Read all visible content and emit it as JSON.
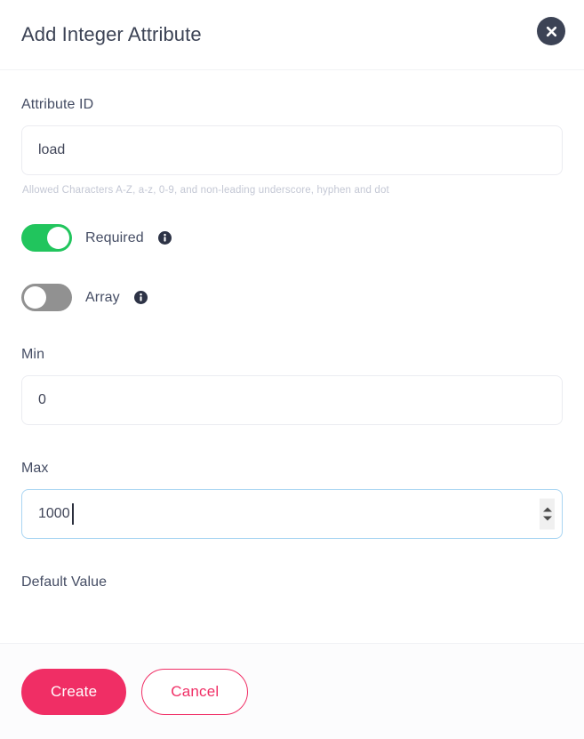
{
  "dialog": {
    "title": "Add Integer Attribute",
    "close_icon": "close-x-icon"
  },
  "form": {
    "attribute_id": {
      "label": "Attribute ID",
      "value": "load",
      "placeholder": "",
      "helper": "Allowed Characters A-Z, a-z, 0-9, and non-leading underscore, hyphen and dot"
    },
    "required_toggle": {
      "label": "Required",
      "state": "on",
      "info_icon": "info-circle-icon"
    },
    "array_toggle": {
      "label": "Array",
      "state": "off",
      "info_icon": "info-circle-icon"
    },
    "min": {
      "label": "Min",
      "value": "0",
      "placeholder": ""
    },
    "max": {
      "label": "Max",
      "value": "1000",
      "placeholder": "",
      "focused": true
    },
    "default_value": {
      "label": "Default Value"
    }
  },
  "footer": {
    "create_label": "Create",
    "cancel_label": "Cancel"
  },
  "colors": {
    "accent_pink": "#f02e65",
    "toggle_on_green": "#21c55d",
    "toggle_off_gray": "#919191",
    "title_text": "#3c4355",
    "focus_border": "#a9d5f2"
  }
}
